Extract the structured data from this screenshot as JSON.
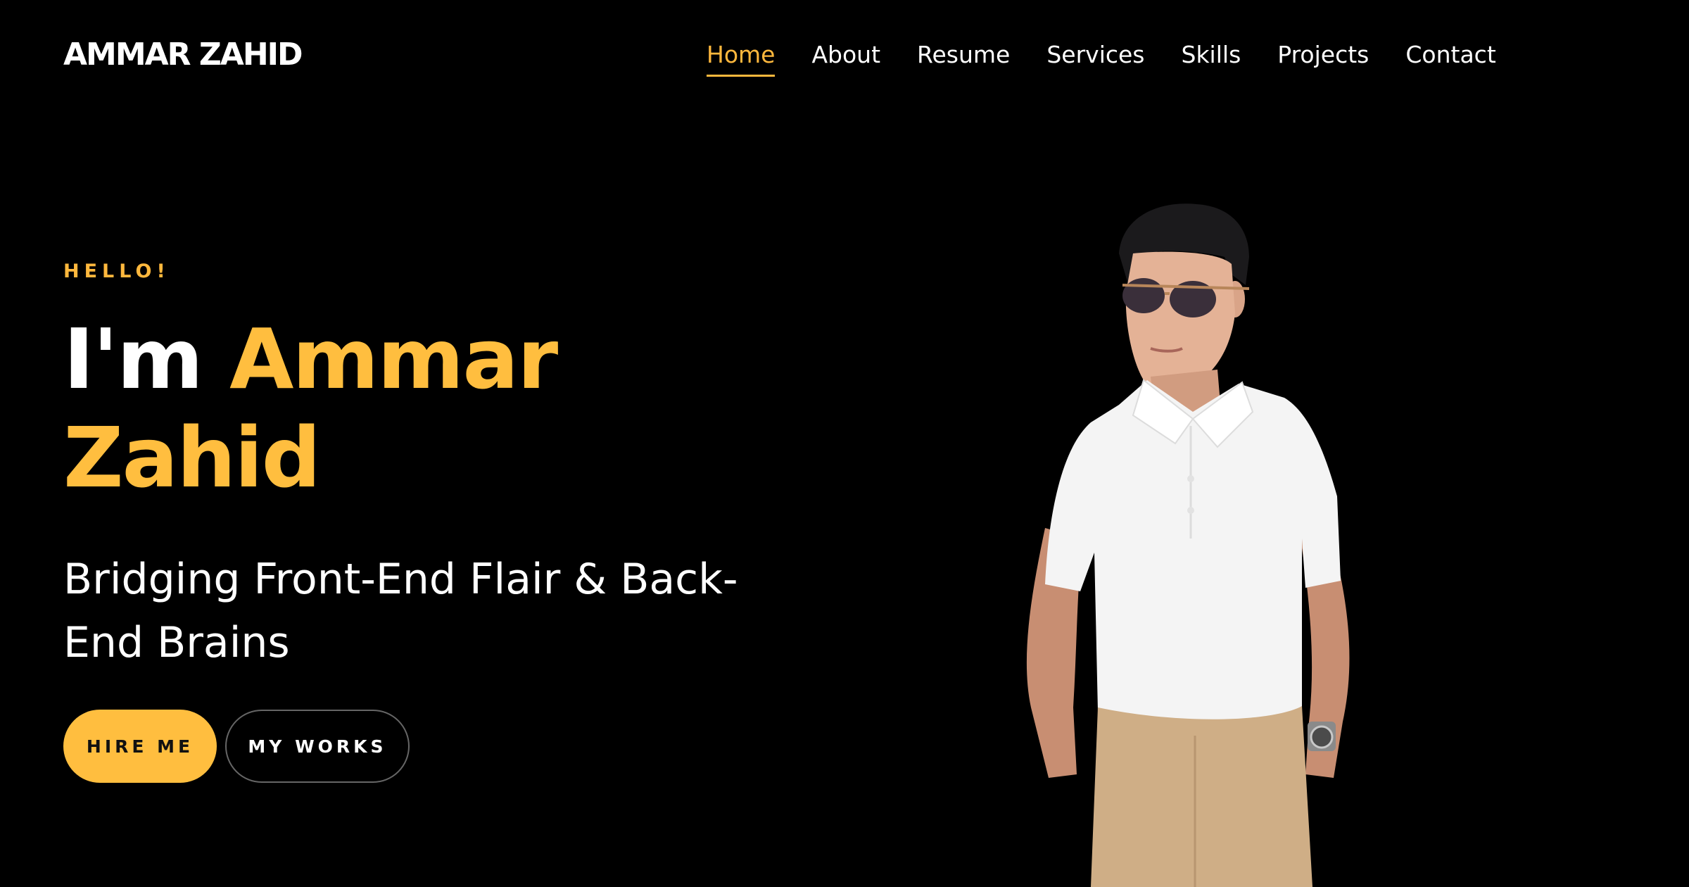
{
  "header": {
    "logo": "AMMAR ZAHID",
    "nav": [
      {
        "label": "Home",
        "active": true
      },
      {
        "label": "About",
        "active": false
      },
      {
        "label": "Resume",
        "active": false
      },
      {
        "label": "Services",
        "active": false
      },
      {
        "label": "Skills",
        "active": false
      },
      {
        "label": "Projects",
        "active": false
      },
      {
        "label": "Contact",
        "active": false
      }
    ]
  },
  "hero": {
    "greeting": "HELLO!",
    "intro": "I'm",
    "first_name": "Ammar",
    "last_name": "Zahid",
    "tagline": "Bridging Front-End Flair & Back-End Brains",
    "buttons": {
      "hire": "HIRE ME",
      "works": "MY WORKS"
    }
  },
  "colors": {
    "background": "#000000",
    "accent": "#ffbe3f",
    "text": "#ffffff"
  }
}
